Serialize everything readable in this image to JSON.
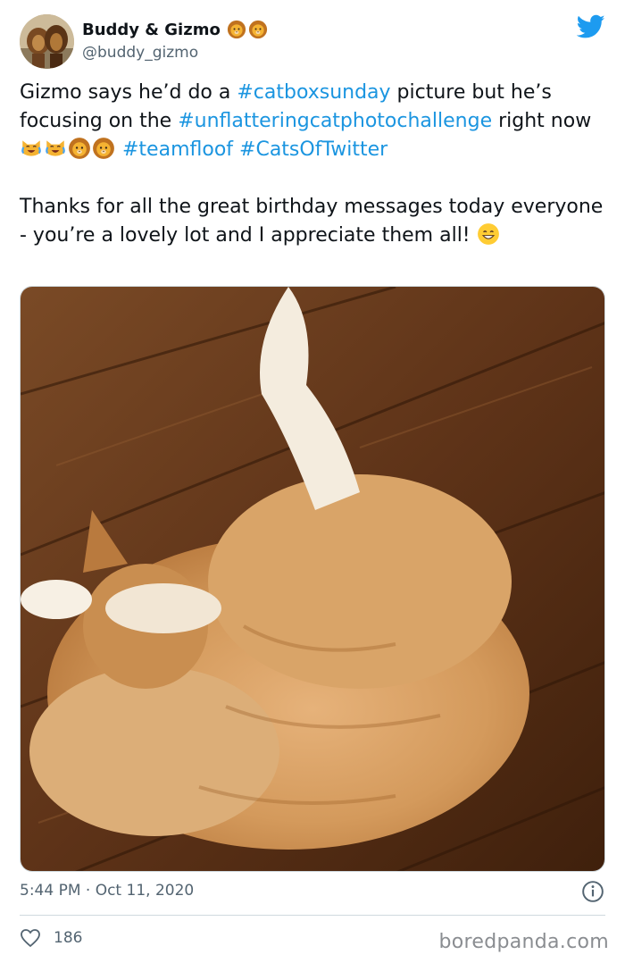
{
  "author": {
    "name": "Buddy & Gizmo",
    "handle": "@buddy_gizmo"
  },
  "tweet": {
    "line1_before": "Gizmo says he’d do a ",
    "tag1": "#catboxsunday",
    "line1_mid": " picture but he’s focusing on the ",
    "tag2": "#unflatteringcatphotochallenge",
    "line1_after": " right now ",
    "tag3": "#teamfloof",
    "tag4": "#CatsOfTwitter",
    "paragraph2": "Thanks for all the great birthday messages today everyone - you’re a lovely lot and I appreciate them all! "
  },
  "timestamp": "5:44 PM · Oct 11, 2020",
  "likes": "186",
  "watermark": "boredpanda.com",
  "colors": {
    "link": "#1b95e0",
    "twitter_blue": "#1d9bf0",
    "muted": "#536471"
  },
  "icons": [
    "lion-emoji-icon",
    "twitter-bird-icon",
    "tears-of-joy-cat-icon",
    "grinning-face-icon",
    "info-icon",
    "heart-icon"
  ]
}
